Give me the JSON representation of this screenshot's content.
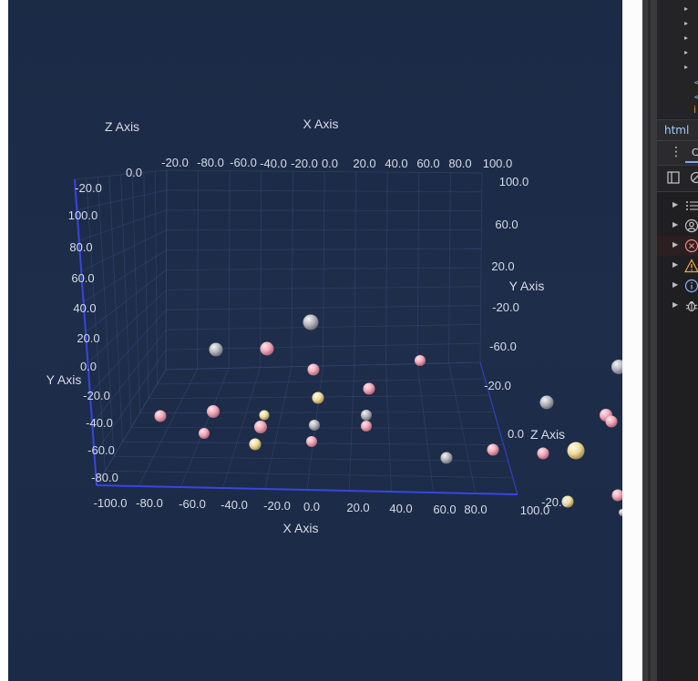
{
  "chart_data": {
    "type": "scatter",
    "subtype": "3d-scatter",
    "axes": {
      "x": {
        "title": "X Axis",
        "ticks_front": [
          "-100.0",
          "-80.0",
          "-60.0",
          "-40.0",
          "-20.0",
          "0.0",
          "20.0",
          "40.0",
          "60.0",
          "80.0",
          "100.0"
        ],
        "ticks_back": [
          "-20.0",
          "-80.0",
          "-60.0",
          "-40.0",
          "-20.0",
          "0.0",
          "20.0",
          "40.0",
          "60.0",
          "80.0",
          "100.0"
        ]
      },
      "y": {
        "title": "Y Axis",
        "ticks_left": [
          "-20.0",
          "100.0",
          "80.0",
          "60.0",
          "40.0",
          "20.0",
          "0.0",
          "-20.0",
          "-40.0",
          "-60.0",
          "-80.0"
        ],
        "ticks_right": [
          "100.0",
          "60.0",
          "20.0",
          "-20.0",
          "-60.0",
          "-20.0"
        ]
      },
      "z": {
        "title": "Z Axis",
        "ticks": [
          "0.0",
          "-20.0"
        ]
      }
    },
    "grid": true,
    "points": [
      {
        "color": "#f0a8b8"
      },
      {
        "color": "#b8b8c0"
      },
      {
        "color": "#f0e0a0"
      }
    ]
  },
  "colors": {
    "background": "#1c2c48",
    "axis_line": "#3a45e0",
    "grid": "#3a4a78",
    "label": "#d8dce6"
  },
  "devtools": {
    "crumb": "html",
    "sidebar_icons": [
      "list-icon",
      "user-circle-icon",
      "error-circle-icon",
      "warning-icon",
      "info-icon",
      "bug-icon"
    ]
  }
}
